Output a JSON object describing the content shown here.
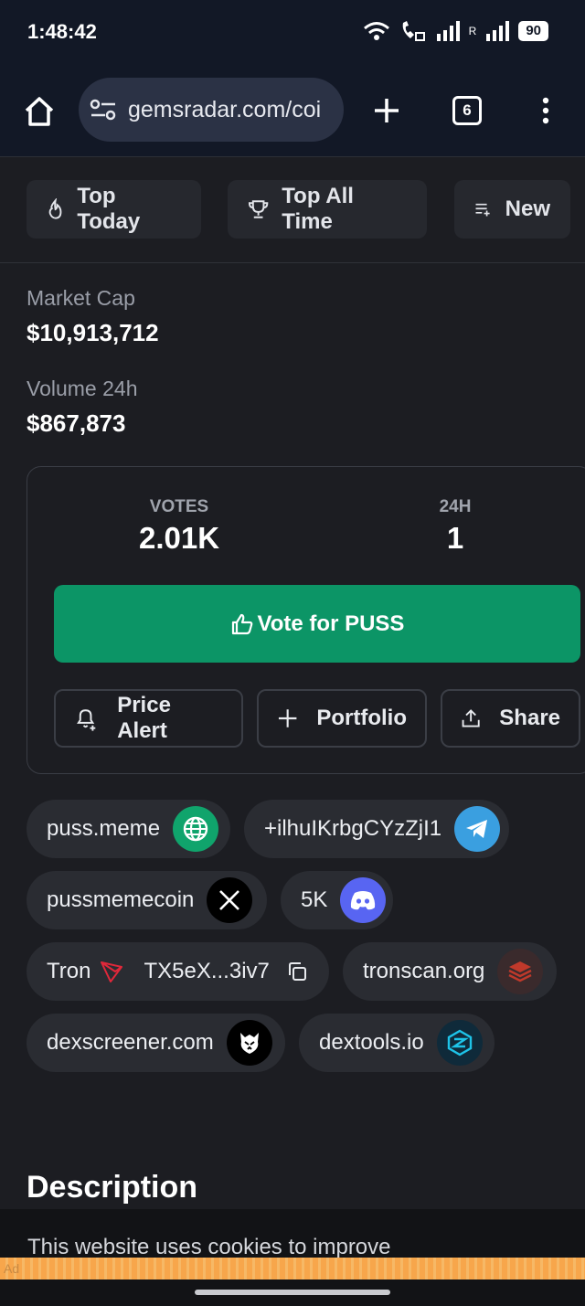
{
  "status_bar": {
    "time": "1:48:42",
    "network": "R",
    "battery": "90"
  },
  "browser": {
    "url": "gemsradar.com/coi",
    "tab_count": "6"
  },
  "filter_tabs": [
    {
      "label": "Top Today",
      "icon": "flame-icon"
    },
    {
      "label": "Top All Time",
      "icon": "trophy-icon"
    },
    {
      "label": "New",
      "icon": "list-add-icon"
    }
  ],
  "stats": {
    "market_cap_label": "Market Cap",
    "market_cap_value": "$10,913,712",
    "volume_label": "Volume 24h",
    "volume_value": "$867,873"
  },
  "votes": {
    "votes_label": "VOTES",
    "votes_value": "2.01K",
    "day_label": "24H",
    "day_value": "1",
    "vote_button": "Vote for PUSS",
    "accent": "#0c9566"
  },
  "actions": {
    "price_alert": "Price Alert",
    "portfolio": "Portfolio",
    "share": "Share"
  },
  "links": {
    "website": "puss.meme",
    "telegram": "+ilhuIKrbgCYzZjI1",
    "twitter": "pussmemecoin",
    "discord": "5K",
    "chain": "Tron",
    "contract": "TX5eX...3iv7",
    "explorer": "tronscan.org",
    "dexscreener": "dexscreener.com",
    "dextools": "dextools.io"
  },
  "description_title": "Description",
  "cookie_text": "This website uses cookies to improve",
  "ad_label": "Ad"
}
